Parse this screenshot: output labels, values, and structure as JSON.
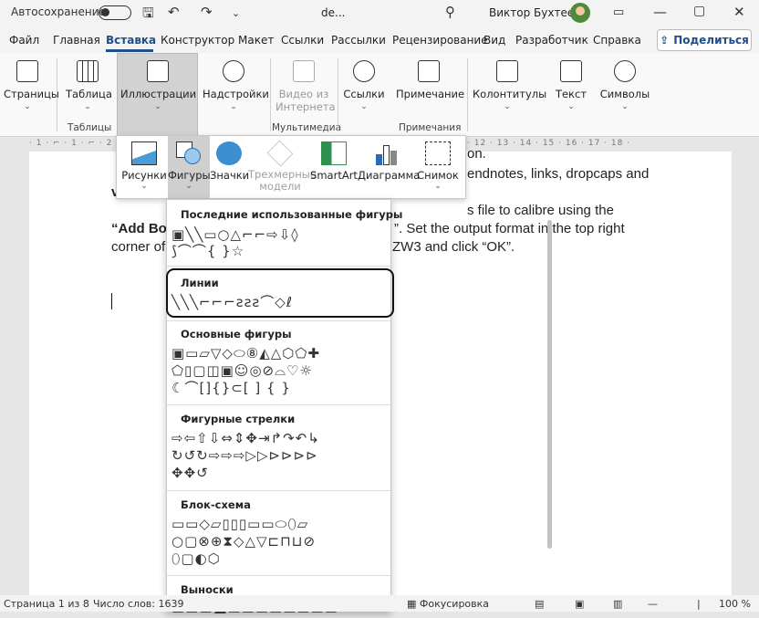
{
  "titlebar": {
    "autosave": "Автосохранение",
    "doc_name": "de...",
    "user": "Виктор Бухтеев",
    "icons": [
      "save-icon",
      "undo-icon",
      "redo-icon",
      "customize-icon",
      "search-icon",
      "ribbon-options-icon",
      "minimize-icon",
      "maximize-icon",
      "close-icon"
    ]
  },
  "tabs": [
    "Файл",
    "Главная",
    "Вставка",
    "Конструктор",
    "Макет",
    "Ссылки",
    "Рассылки",
    "Рецензирование",
    "Вид",
    "Разработчик",
    "Справка"
  ],
  "active_tab": "Вставка",
  "share_label": "Поделиться",
  "ribbon": {
    "pages": "Страницы",
    "table": "Таблица",
    "illustrations": "Иллюстрации",
    "addins": "Надстройки",
    "video": "Видео из Интернета",
    "links": "Ссылки",
    "comment": "Примечание",
    "header_footer": "Колонтитулы",
    "text": "Текст",
    "symbols": "Символы",
    "groups": {
      "tables": "Таблицы",
      "media": "Мультимедиа",
      "comments": "Примечания"
    }
  },
  "gallery": {
    "pictures": "Рисунки",
    "shapes": "Фигуры",
    "icons": "Значки",
    "models3d": "Трехмерные модели",
    "smartart": "SmartArt",
    "chart": "Диаграмма",
    "screenshot": "Снимок"
  },
  "shapes_menu": {
    "recent": "Последние использованные фигуры",
    "lines": "Линии",
    "basic": "Основные фигуры",
    "arrows": "Фигурные стрелки",
    "flowchart": "Блок-схема",
    "callouts": "Выноски",
    "rows": {
      "recent1": "▣╲╲▭○△⌐⌐⇨⇩◊",
      "recent2": "⟆⌒⌒{ }☆",
      "lines1": "╲╲╲⌐⌐⌐ƨƨƨ⌒◇ℓ",
      "basic1": "▣▭▱▽◇⬭⑧◭△⬡⬠✚",
      "basic2": "⬠▯▢◫▣☺◎⊘⌓♡☼",
      "basic3": "☾⌒[]{}⊂[ ] { }",
      "arrows1": "⇨⇦⇧⇩⇔⇕✥⇥↱↷↶↳",
      "arrows2": "↻↺↻⇨⇨⇨▷▷⊳⊳⊳⊳",
      "arrows3": "✥✥↺",
      "flow1": "▭▭◇▱▯▯▯▭▭⬭⬯▱",
      "flow2": "○▢⊗⊕⧗◇△▽⊏⊓⊔⊘",
      "flow3": "⬯▢◐⬡",
      "callouts1": "▭▭▭☁▭▭▭▭▭▭▭▭"
    }
  },
  "document": {
    "line1_tail": "on.",
    "line2_tail": "endnotes, links, dropcaps and",
    "line3_head": "v",
    "line4_tail": "s file to calibre using the",
    "line5_head": "“Add Bo",
    "line5_tail": "”.  Set the output format in the top right",
    "line6_head": "corner of",
    "line6_tail": "ZW3 and click “OK”."
  },
  "status": {
    "page": "Страница 1 из 8",
    "words": "Число слов: 1639",
    "focus": "Фокусировка",
    "zoom": "100 %"
  }
}
